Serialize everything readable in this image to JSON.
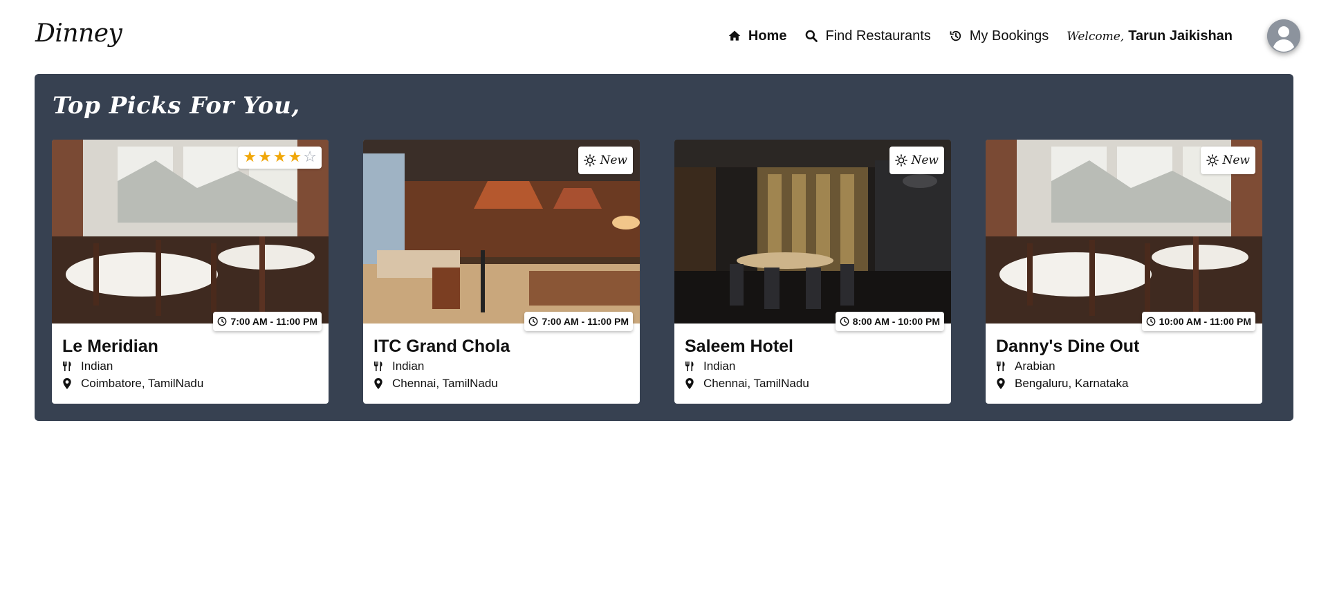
{
  "brand": "Dinney",
  "nav": {
    "home_label": "Home",
    "find_label": "Find Restaurants",
    "bookings_label": "My Bookings",
    "welcome_word": "Welcome,",
    "user_name": "Tarun Jaikishan"
  },
  "section_title": "Top Picks For You,",
  "icons": {
    "home": "home-icon",
    "search": "search-icon",
    "history": "history-icon",
    "avatar": "user-avatar-icon",
    "clock": "clock-icon",
    "cuisine": "utensils-icon",
    "location": "map-pin-icon",
    "new": "sun-icon",
    "star": "star-icon"
  },
  "colors": {
    "panel": "#374151",
    "star": "#f0a70a",
    "card": "#ffffff"
  },
  "restaurants": [
    {
      "name": "Le Meridian",
      "cuisine": "Indian",
      "location": "Coimbatore, TamilNadu",
      "hours": "7:00 AM - 11:00 PM",
      "badge": "rating",
      "rating": 4,
      "rating_max": 5
    },
    {
      "name": "ITC Grand Chola",
      "cuisine": "Indian",
      "location": "Chennai, TamilNadu",
      "hours": "7:00 AM - 11:00 PM",
      "badge": "new",
      "badge_text": "New"
    },
    {
      "name": "Saleem Hotel",
      "cuisine": "Indian",
      "location": "Chennai, TamilNadu",
      "hours": "8:00 AM - 10:00 PM",
      "badge": "new",
      "badge_text": "New"
    },
    {
      "name": "Danny's Dine Out",
      "cuisine": "Arabian",
      "location": "Bengaluru, Karnataka",
      "hours": "10:00 AM - 11:00 PM",
      "badge": "new",
      "badge_text": "New"
    }
  ]
}
